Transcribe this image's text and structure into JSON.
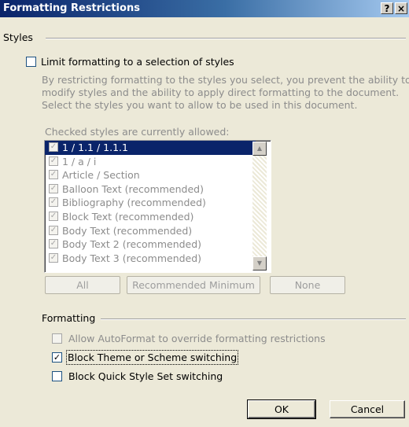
{
  "window": {
    "title": "Formatting Restrictions",
    "help_glyph": "?",
    "close_glyph": "×"
  },
  "styles_group": {
    "label": "Styles",
    "limit_checkbox": {
      "label": "Limit formatting to a selection of styles",
      "checked": false
    },
    "description": "By restricting formatting to the styles you select, you prevent the ability to modify styles and the ability to apply direct formatting to the document. Select the styles you want to allow to be used in this document.",
    "checked_label": "Checked styles are currently allowed:",
    "styles": [
      {
        "label": "1 / 1.1 / 1.1.1",
        "checked": true,
        "selected": true
      },
      {
        "label": "1 / a / i",
        "checked": true
      },
      {
        "label": "Article / Section",
        "checked": true
      },
      {
        "label": "Balloon Text (recommended)",
        "checked": true
      },
      {
        "label": "Bibliography (recommended)",
        "checked": true
      },
      {
        "label": "Block Text (recommended)",
        "checked": true
      },
      {
        "label": "Body Text (recommended)",
        "checked": true
      },
      {
        "label": "Body Text 2 (recommended)",
        "checked": true
      },
      {
        "label": "Body Text 3 (recommended)",
        "checked": true
      }
    ],
    "buttons": {
      "all": "All",
      "recommended": "Recommended Minimum",
      "none": "None"
    }
  },
  "formatting_group": {
    "label": "Formatting",
    "autoformat": {
      "label": "Allow AutoFormat to override formatting restrictions",
      "checked": false
    },
    "block_theme": {
      "label": "Block Theme or Scheme switching",
      "checked": true
    },
    "block_quick_style": {
      "label": "Block Quick Style Set switching",
      "checked": false
    }
  },
  "footer": {
    "ok": "OK",
    "cancel": "Cancel"
  }
}
